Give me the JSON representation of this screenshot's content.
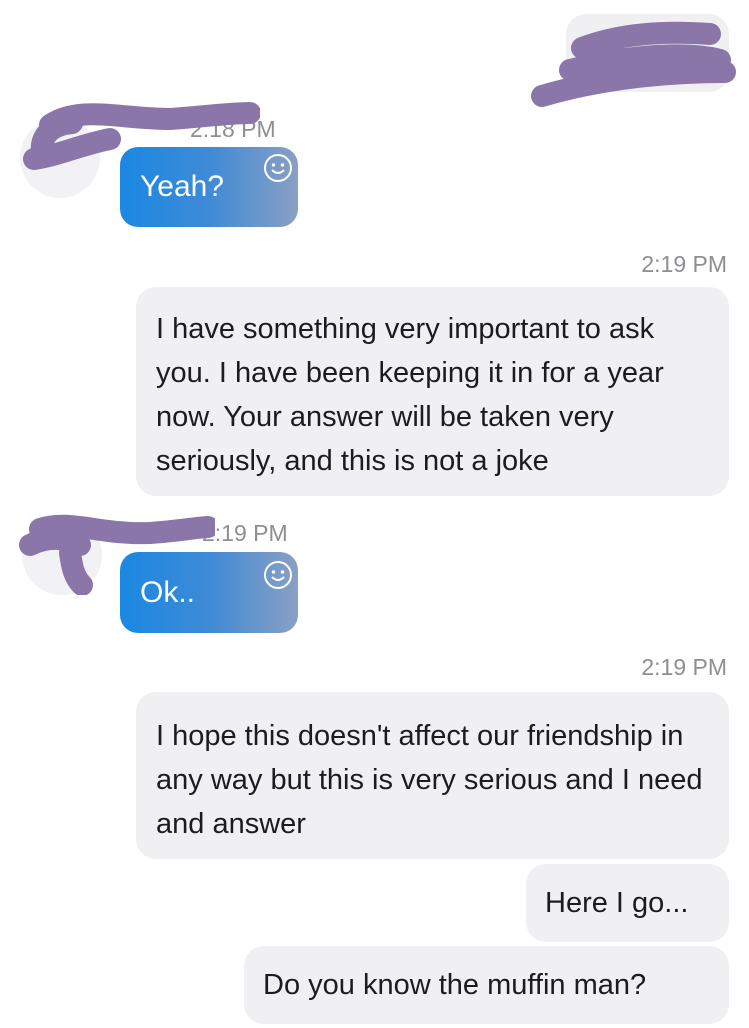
{
  "colors": {
    "incoming_bubble_start": "#1a88e2",
    "incoming_bubble_end": "#8aa0c4",
    "outgoing_bubble": "#f0f0f3",
    "timestamp": "#8e8e93",
    "redaction": "#8a76a8"
  },
  "messages": [
    {
      "direction": "incoming",
      "timestamp": "2:18 PM",
      "text": "Yeah?",
      "reaction_icon": "smiley-face-icon"
    },
    {
      "direction": "outgoing",
      "timestamp": "2:19 PM",
      "text": "I have something very important to ask you. I have been keeping it in for a year now. Your answer will be taken very seriously, and this is not a joke"
    },
    {
      "direction": "incoming",
      "timestamp": "2:19 PM",
      "text": "Ok..",
      "reaction_icon": "smiley-face-icon"
    },
    {
      "direction": "outgoing",
      "timestamp": "2:19 PM",
      "text": "I hope this doesn't affect our friendship in any way but this is very serious and I need and answer"
    },
    {
      "direction": "outgoing",
      "text": "Here I go..."
    },
    {
      "direction": "outgoing",
      "text": "Do you know the muffin man?"
    }
  ]
}
